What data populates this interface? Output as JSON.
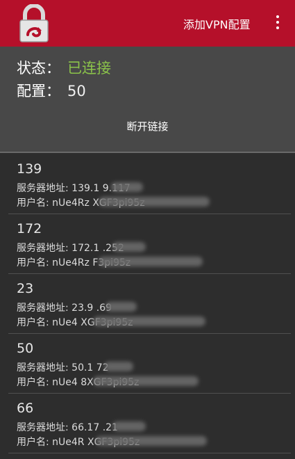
{
  "toolbar": {
    "add_vpn_label": "添加VPN配置",
    "overflow_icon": "more-vert-icon",
    "logo_icon": "lock-logo-icon",
    "background_color": "#b5102a"
  },
  "status": {
    "state_label": "状态：",
    "state_value": "已连接",
    "state_color": "#8bc34a",
    "config_label": "配置：",
    "config_value": "50",
    "disconnect_label": "断开链接"
  },
  "servers": [
    {
      "name": "139",
      "address": "服务器地址: 139.1      9.117",
      "user": "用户名: nUe4Rz              XGF3pi95z"
    },
    {
      "name": "172",
      "address": "服务器地址: 172.1      .252",
      "user": "用户名: nUe4Rz              F3pi95z"
    },
    {
      "name": "23",
      "address": "服务器地址: 23.9      .69",
      "user": "用户名: nUe4               XGF3pi95z"
    },
    {
      "name": "50",
      "address": "服务器地址: 50.1      72",
      "user": "用户名: nUe4             8XGF3pi95z"
    },
    {
      "name": "66",
      "address": "服务器地址: 66.17      .21",
      "user": "用户名: nUe4R              XGF3pi95z"
    }
  ]
}
